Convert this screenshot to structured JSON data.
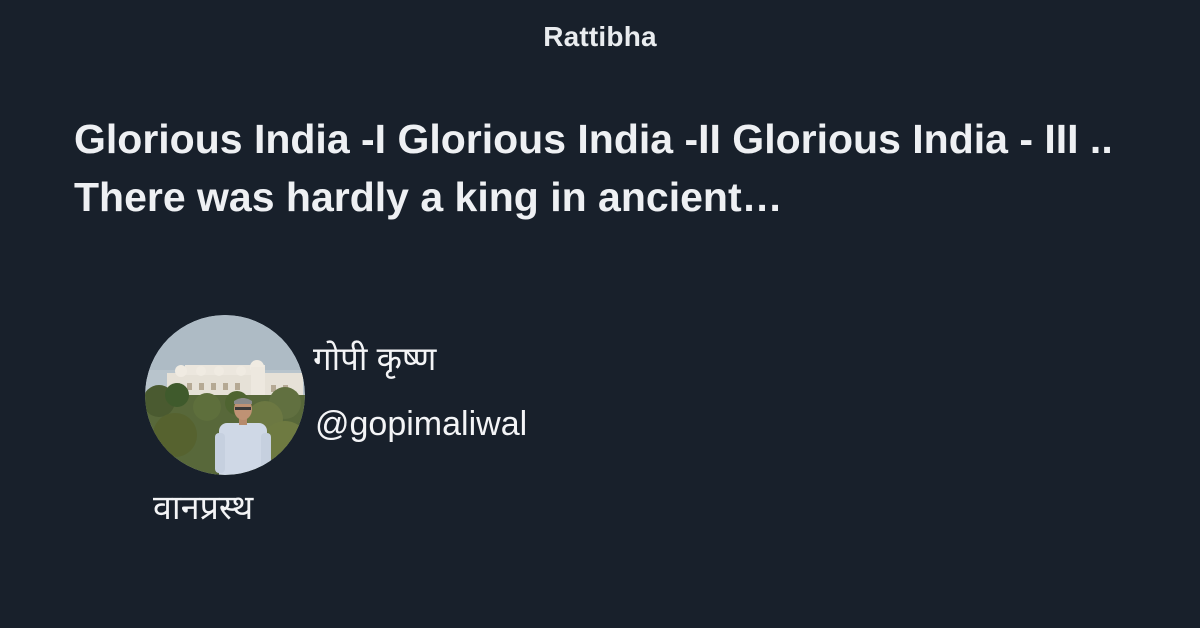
{
  "brand": {
    "name": "Rattibha"
  },
  "thread": {
    "title": "Glorious India -I Glorious India -II Glorious India - III .. There was hardly a king in ancient…"
  },
  "author": {
    "display_name": "गोपी कृष्ण",
    "handle": "@gopimaliwal",
    "bio": "वानप्रस्थ",
    "avatar_icon": "profile-photo"
  },
  "colors": {
    "background": "#18202b",
    "text": "#f0f2f5"
  }
}
